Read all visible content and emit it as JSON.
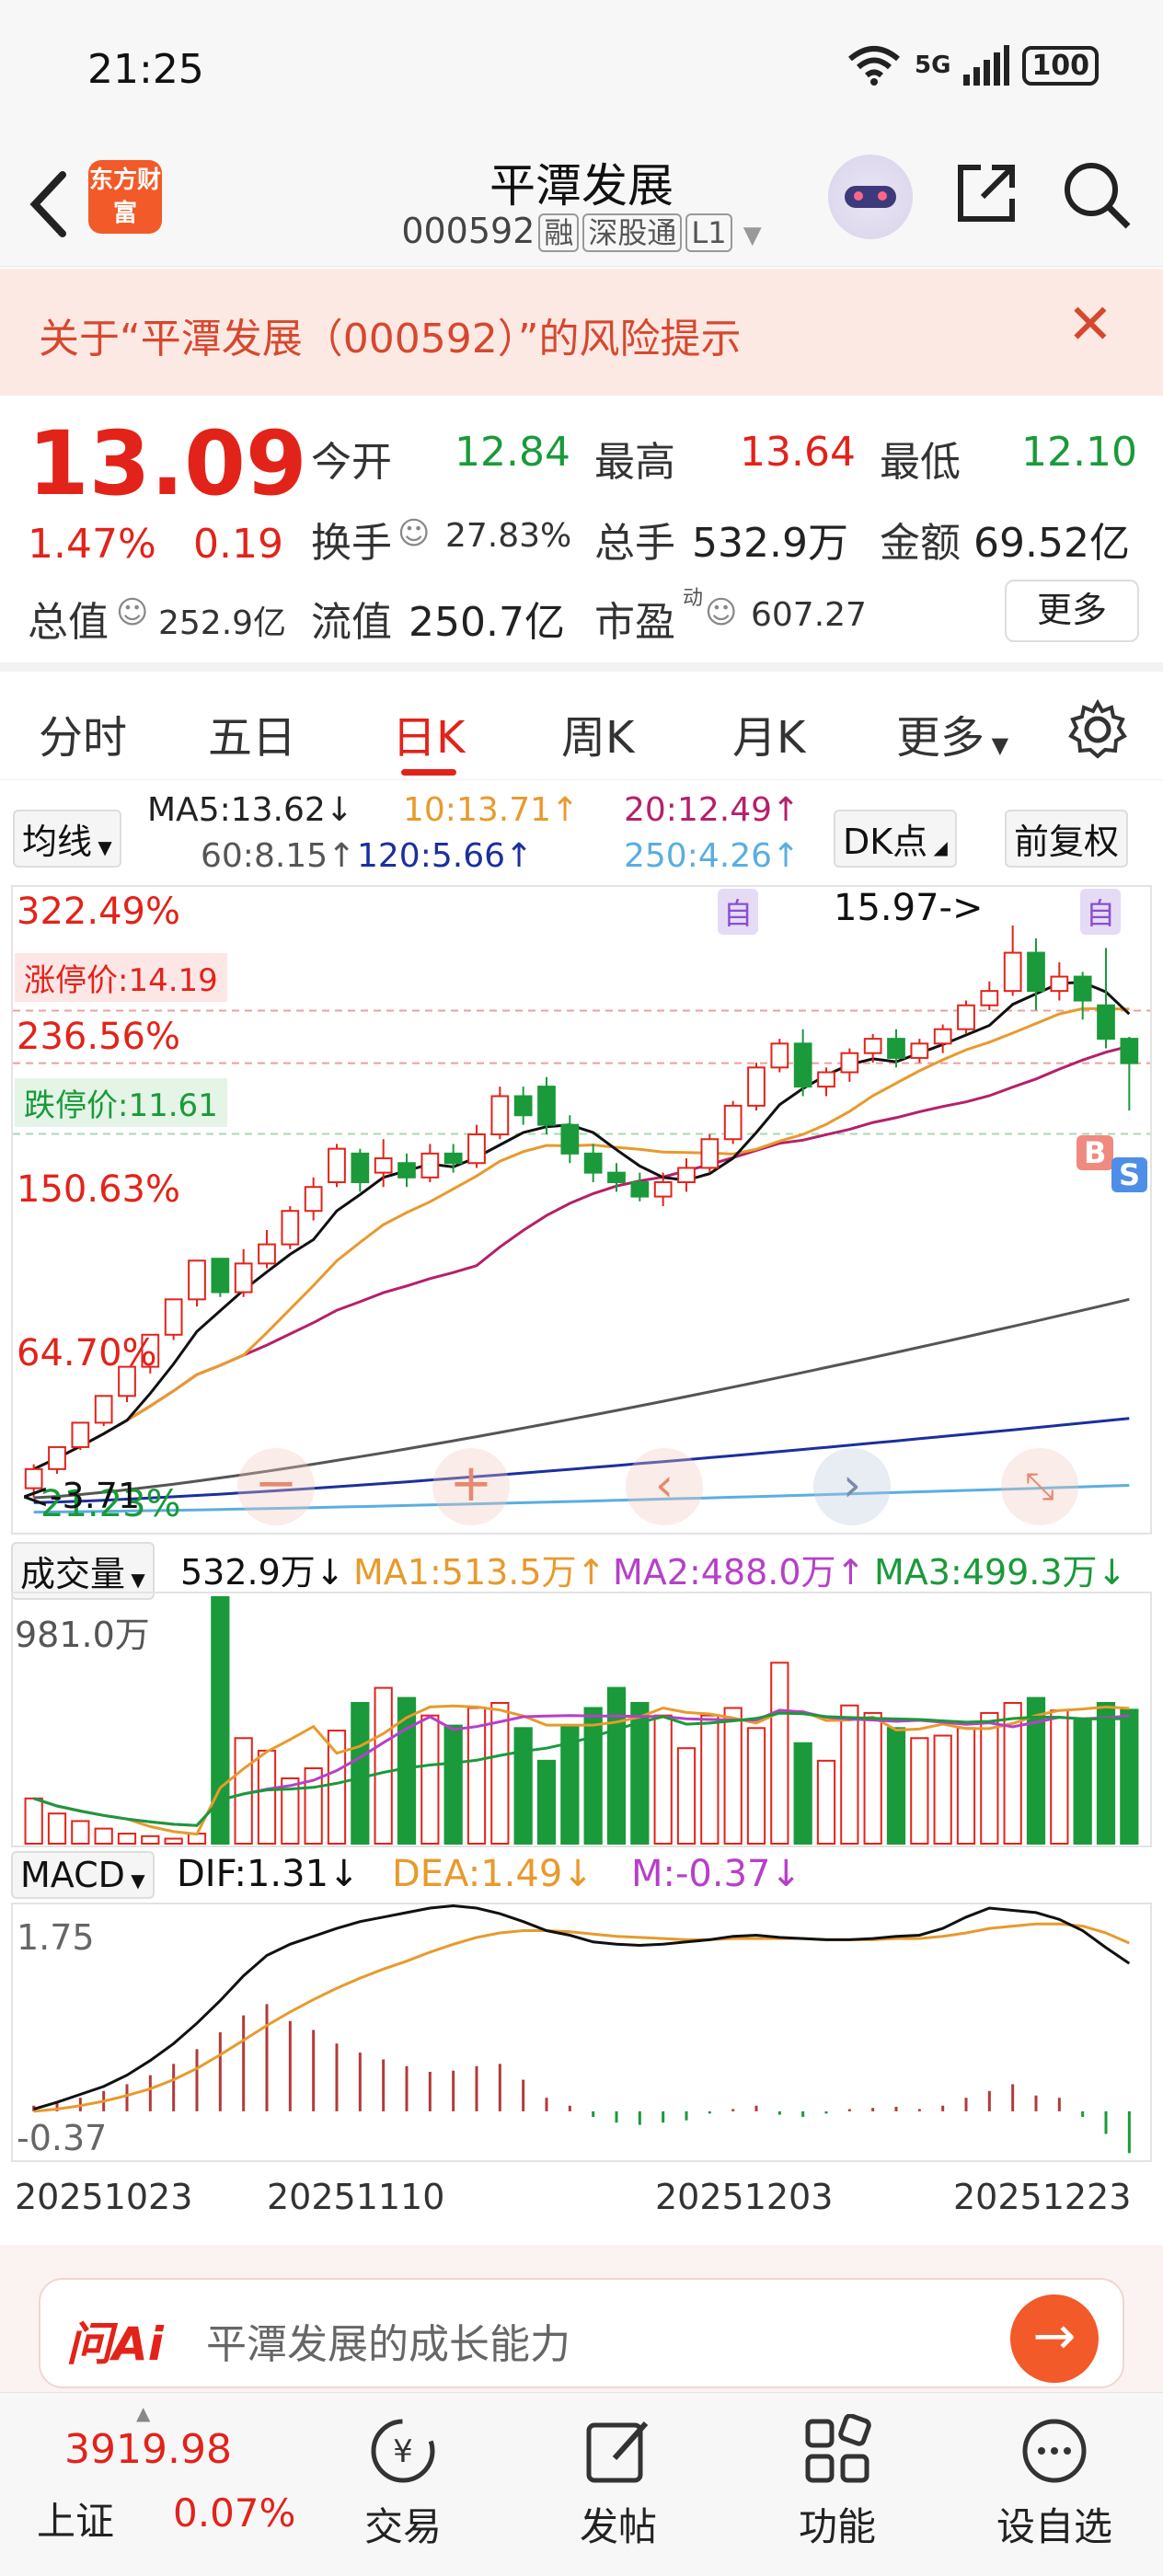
{
  "status_bar": {
    "time": "21:25",
    "network": "5G",
    "battery": "100"
  },
  "header": {
    "app_logo": "东方财富",
    "title": "平潭发展",
    "code": "000592",
    "tags": [
      "融",
      "深股通",
      "L1"
    ]
  },
  "risk_banner": {
    "text": "关于“平潭发展（000592）”的风险提示"
  },
  "quote": {
    "price": "13.09",
    "change_pct": "1.47%",
    "change": "0.19",
    "open_label": "今开",
    "open": "12.84",
    "high_label": "最高",
    "high": "13.64",
    "low_label": "最低",
    "low": "12.10",
    "turnover_label": "换手",
    "turnover": "27.83%",
    "volume_label": "总手",
    "volume": "532.9万",
    "amount_label": "金额",
    "amount": "69.52亿",
    "mktcap_label": "总值",
    "mktcap": "252.9亿",
    "float_label": "流值",
    "float_cap": "250.7亿",
    "pe_label": "市盈",
    "pe_sup": "动",
    "pe": "607.27",
    "more_label": "更多"
  },
  "tabs": [
    "分时",
    "五日",
    "日K",
    "周K",
    "月K",
    "更多"
  ],
  "ma_legend": {
    "selector": "均线",
    "ma5": "MA5:13.62↓",
    "ma10": "10:13.71↑",
    "ma20": "20:12.49↑",
    "ma60": "60:8.15↑",
    "ma120": "120:5.66↑",
    "ma250": "250:4.26↑",
    "dk_label": "DK点",
    "adjust_label": "前复权"
  },
  "kline": {
    "y_labels": [
      "322.49%",
      "236.56%",
      "150.63%",
      "64.70%",
      "21.23%"
    ],
    "limit_up": "涨停价:14.19",
    "limit_down": "跌停价:11.61",
    "high_mark": "15.97->",
    "low_mark": "<-3.71",
    "auto_label": "自",
    "buy_label": "B",
    "sell_label": "S"
  },
  "volume": {
    "selector": "成交量",
    "value": "532.9万↓",
    "ma1": "MA1:513.5万↑",
    "ma2": "MA2:488.0万↑",
    "ma3": "MA3:499.3万↓",
    "y_label": "981.0万"
  },
  "macd": {
    "selector": "MACD",
    "dif": "DIF:1.31↓",
    "dea": "DEA:1.49↓",
    "m": "M:-0.37↓",
    "y_top": "1.75",
    "y_bottom": "-0.37"
  },
  "dates": [
    "20251023",
    "20251110",
    "20251203",
    "20251223"
  ],
  "ask_ai": {
    "logo": "问Ai",
    "placeholder": "平潭发展的成长能力"
  },
  "bottom_nav": {
    "index_value": "3919.98",
    "index_name": "上证",
    "index_change": "0.07%",
    "items": [
      "交易",
      "发帖",
      "功能",
      "设自选"
    ]
  },
  "colors": {
    "up": "#e2231a",
    "down": "#1a9a3a",
    "ma5": "#111111",
    "ma10": "#e89a2c",
    "ma20": "#b5206a",
    "ma60": "#555555",
    "ma120": "#1b2f9e",
    "ma250": "#5aaee0"
  },
  "chart_data": {
    "type": "candlestick",
    "x_range": [
      "20251023",
      "20251223"
    ],
    "candles": [
      {
        "o": 4.2,
        "c": 4.6,
        "h": 4.7,
        "l": 4.0
      },
      {
        "o": 4.6,
        "c": 5.06,
        "h": 5.06,
        "l": 4.5
      },
      {
        "o": 5.06,
        "c": 5.57,
        "h": 5.57,
        "l": 5.0
      },
      {
        "o": 5.57,
        "c": 6.13,
        "h": 6.13,
        "l": 5.5
      },
      {
        "o": 6.13,
        "c": 6.74,
        "h": 6.74,
        "l": 6.0
      },
      {
        "o": 6.74,
        "c": 7.41,
        "h": 7.41,
        "l": 6.6
      },
      {
        "o": 7.41,
        "c": 8.15,
        "h": 8.15,
        "l": 7.3
      },
      {
        "o": 8.15,
        "c": 8.96,
        "h": 8.96,
        "l": 8.0
      },
      {
        "o": 9.0,
        "c": 8.3,
        "h": 9.0,
        "l": 8.2
      },
      {
        "o": 8.3,
        "c": 8.9,
        "h": 9.2,
        "l": 8.2
      },
      {
        "o": 8.9,
        "c": 9.3,
        "h": 9.6,
        "l": 8.8
      },
      {
        "o": 9.3,
        "c": 10.0,
        "h": 10.1,
        "l": 9.2
      },
      {
        "o": 10.0,
        "c": 10.5,
        "h": 10.7,
        "l": 9.8
      },
      {
        "o": 10.6,
        "c": 11.3,
        "h": 11.4,
        "l": 10.5
      },
      {
        "o": 11.2,
        "c": 10.6,
        "h": 11.3,
        "l": 10.4
      },
      {
        "o": 10.8,
        "c": 11.1,
        "h": 11.5,
        "l": 10.5
      },
      {
        "o": 11.0,
        "c": 10.7,
        "h": 11.2,
        "l": 10.5
      },
      {
        "o": 10.7,
        "c": 11.2,
        "h": 11.4,
        "l": 10.6
      },
      {
        "o": 11.2,
        "c": 11.0,
        "h": 11.4,
        "l": 10.8
      },
      {
        "o": 11.0,
        "c": 11.6,
        "h": 11.8,
        "l": 10.9
      },
      {
        "o": 11.6,
        "c": 12.4,
        "h": 12.6,
        "l": 11.5
      },
      {
        "o": 12.4,
        "c": 12.0,
        "h": 12.6,
        "l": 11.8
      },
      {
        "o": 12.6,
        "c": 11.8,
        "h": 12.8,
        "l": 11.6
      },
      {
        "o": 11.8,
        "c": 11.2,
        "h": 12.0,
        "l": 11.0
      },
      {
        "o": 11.2,
        "c": 10.8,
        "h": 11.4,
        "l": 10.6
      },
      {
        "o": 10.8,
        "c": 10.6,
        "h": 11.0,
        "l": 10.4
      },
      {
        "o": 10.6,
        "c": 10.3,
        "h": 10.8,
        "l": 10.2
      },
      {
        "o": 10.3,
        "c": 10.6,
        "h": 10.8,
        "l": 10.1
      },
      {
        "o": 10.6,
        "c": 10.9,
        "h": 11.1,
        "l": 10.4
      },
      {
        "o": 10.9,
        "c": 11.5,
        "h": 11.6,
        "l": 10.8
      },
      {
        "o": 11.5,
        "c": 12.2,
        "h": 12.3,
        "l": 11.4
      },
      {
        "o": 12.2,
        "c": 13.0,
        "h": 13.1,
        "l": 12.1
      },
      {
        "o": 13.0,
        "c": 13.5,
        "h": 13.6,
        "l": 12.9
      },
      {
        "o": 13.5,
        "c": 12.6,
        "h": 13.8,
        "l": 12.4
      },
      {
        "o": 12.6,
        "c": 12.9,
        "h": 13.0,
        "l": 12.4
      },
      {
        "o": 12.9,
        "c": 13.3,
        "h": 13.4,
        "l": 12.7
      },
      {
        "o": 13.3,
        "c": 13.6,
        "h": 13.7,
        "l": 13.1
      },
      {
        "o": 13.6,
        "c": 13.2,
        "h": 13.8,
        "l": 13.0
      },
      {
        "o": 13.2,
        "c": 13.5,
        "h": 13.6,
        "l": 13.1
      },
      {
        "o": 13.5,
        "c": 13.8,
        "h": 13.9,
        "l": 13.3
      },
      {
        "o": 13.8,
        "c": 14.3,
        "h": 14.4,
        "l": 13.7
      },
      {
        "o": 14.3,
        "c": 14.6,
        "h": 14.8,
        "l": 14.2
      },
      {
        "o": 14.6,
        "c": 15.4,
        "h": 15.97,
        "l": 14.5
      },
      {
        "o": 15.4,
        "c": 14.6,
        "h": 15.7,
        "l": 14.2
      },
      {
        "o": 14.6,
        "c": 14.9,
        "h": 15.2,
        "l": 14.4
      },
      {
        "o": 14.9,
        "c": 14.4,
        "h": 15.0,
        "l": 14.0
      },
      {
        "o": 14.3,
        "c": 13.6,
        "h": 15.5,
        "l": 13.4
      },
      {
        "o": 13.6,
        "c": 13.09,
        "h": 13.64,
        "l": 12.1
      }
    ],
    "ma_note": "MA lines: MA5 black, MA10 orange, MA20 magenta, MA60 gray, MA120 navy, MA250 light blue"
  }
}
